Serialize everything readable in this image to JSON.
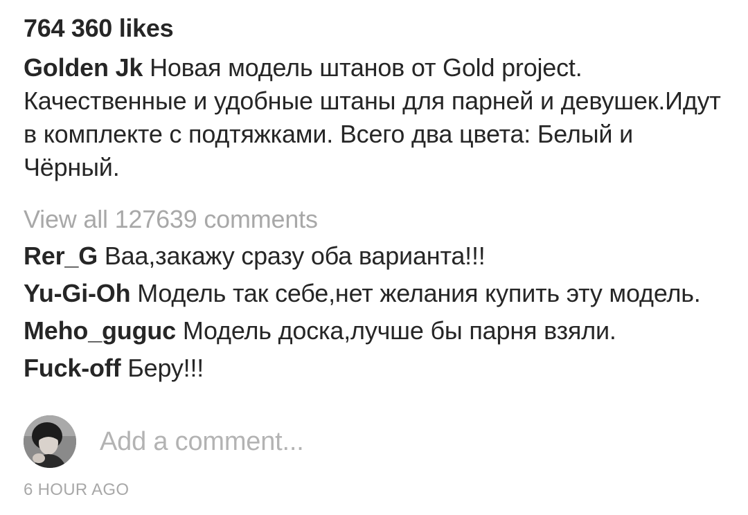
{
  "post": {
    "likes": "764 360 likes",
    "caption": {
      "username": "Golden Jk",
      "text": "Новая модель штанов от Gold project. Качественные и удобные штаны для парней и девушек.Идут в комплекте с подтяжками. Всего два цвета: Белый и Чёрный."
    },
    "view_all_comments": "View all 127639 comments",
    "comments": [
      {
        "username": "Rer_G",
        "text": "Ваа,закажу сразу оба варианта!!!"
      },
      {
        "username": "Yu-Gi-Oh",
        "text": "Модель так себе,нет желания купить эту модель."
      },
      {
        "username": "Meho_guguc",
        "text": "Модель доска,лучше бы парня взяли."
      },
      {
        "username": "Fuck-off",
        "text": "Беру!!!"
      }
    ],
    "add_comment": {
      "placeholder": "Add a comment..."
    },
    "timestamp": "6 HOUR AGO"
  },
  "colors": {
    "text_primary": "#262626",
    "text_secondary": "#a8a8a8",
    "placeholder": "#b3b3b3",
    "background": "#ffffff"
  },
  "icons": {
    "avatar": "user-avatar-photo"
  }
}
